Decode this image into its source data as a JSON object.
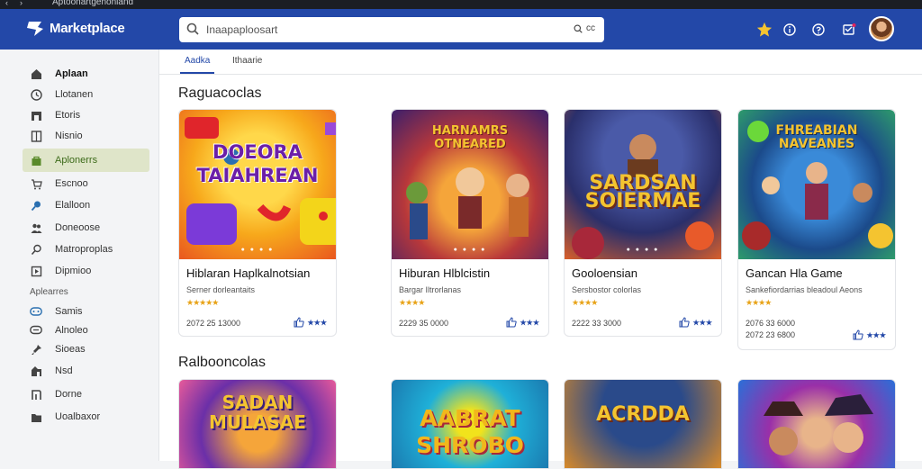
{
  "app": {
    "name": "Marketplace"
  },
  "search": {
    "placeholder": "Inaapaploosart",
    "shortcut": "cc"
  },
  "header_icons": [
    "star-icon",
    "info-icon",
    "help-icon",
    "message-icon"
  ],
  "tabs": [
    {
      "label": "Aadka",
      "active": true
    },
    {
      "label": "Ithaarie",
      "active": false
    }
  ],
  "sidebar": {
    "items": [
      {
        "label": "Aplaan",
        "icon": "home-icon",
        "bold": true
      },
      {
        "label": "Llotanen",
        "icon": "clock-icon"
      },
      {
        "label": "Etoris",
        "icon": "store-icon"
      },
      {
        "label": "Nisnio",
        "icon": "document-icon"
      },
      {
        "label": "Aplonerrs",
        "icon": "bag-icon",
        "active": true
      },
      {
        "label": "Escnoo",
        "icon": "cart-icon"
      },
      {
        "label": "Elalloon",
        "icon": "search-icon"
      },
      {
        "label": "Doneoose",
        "icon": "people-icon"
      },
      {
        "label": "Matroproplas",
        "icon": "magnifier-icon"
      },
      {
        "label": "Dipmioo",
        "icon": "monitor-icon"
      }
    ],
    "section_label": "Aplearres",
    "items2": [
      {
        "label": "Samis",
        "icon": "gamepad-icon"
      },
      {
        "label": "Alnoleo",
        "icon": "chat-icon"
      },
      {
        "label": "Sioeas",
        "icon": "pin-icon"
      },
      {
        "label": "Nsd",
        "icon": "puzzle-icon"
      },
      {
        "label": "Dorne",
        "icon": "flag-icon"
      },
      {
        "label": "Uoalbaxor",
        "icon": "folder-icon"
      }
    ]
  },
  "sections": [
    {
      "title": "Raguacoclas"
    },
    {
      "title": "Ralbooncolas"
    }
  ],
  "cards": [
    {
      "title": "Hiblaran Haplkalnotsian",
      "subtitle": "Serner dorleantaits",
      "stars": "★★★★★",
      "price": "2072 25 13000",
      "price2": "",
      "action": "★★★",
      "thumb_text": "DOEORA\nTAIAHREAN",
      "colors": [
        "#f7b733",
        "#f36f21"
      ]
    },
    {
      "title": "Hiburan Hlblcistin",
      "subtitle": "Bargar Iltrorlanas",
      "stars": "★★★★",
      "price": "2229 35 0000",
      "price2": "",
      "action": "★★★",
      "thumb_text": "HARNAMRS\nOTNEARED",
      "colors": [
        "#6b2fa8",
        "#e06b2e"
      ]
    },
    {
      "title": "Gooloensian",
      "subtitle": "Sersbostor colorlas",
      "stars": "★★★★",
      "price": "2222 33 3000",
      "price2": "",
      "action": "★★★",
      "thumb_text": "SARDSAN\nSOIERMAE",
      "colors": [
        "#2a3c8a",
        "#d95f2a"
      ]
    },
    {
      "title": "Gancan Hla Game",
      "subtitle": "Sankefiordarrias bleadoul Aeons",
      "stars": "★★★★",
      "price": "2076 33 6000",
      "price2": "2072 23 6800",
      "action": "★★★",
      "thumb_text": "FHREABIAN\nNAVEANES",
      "colors": [
        "#1b5aa8",
        "#2e9b6b"
      ]
    }
  ],
  "cards_row2": [
    {
      "thumb_text": "SADAN\nMULASAE",
      "colors": [
        "#3a1f7a",
        "#e85a9a"
      ]
    },
    {
      "thumb_text": "AABRAT\nSHROBO",
      "colors": [
        "#1fb0d8",
        "#f1b71c"
      ]
    },
    {
      "thumb_text": "ACRDDA",
      "colors": [
        "#1a3b6b",
        "#d88a2a"
      ]
    },
    {
      "thumb_text": "",
      "colors": [
        "#9a2fa8",
        "#2a6fd8"
      ]
    }
  ],
  "os_title": "Aptoonartgenoniand"
}
